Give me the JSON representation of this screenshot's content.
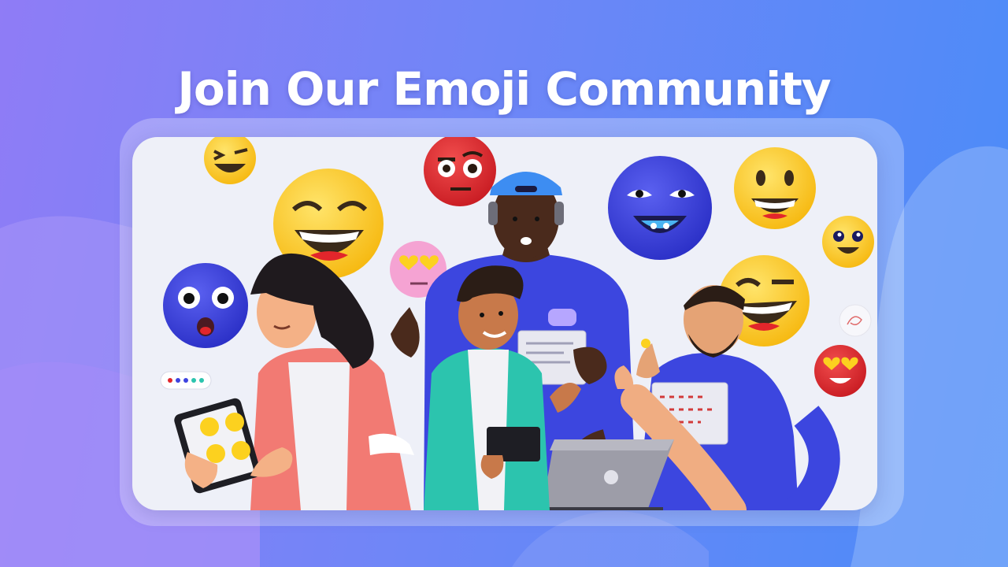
{
  "hero": {
    "title": "Join Our Emoji Community"
  },
  "illustration": {
    "emojis": [
      "winking-grin-emoji",
      "laughing-big-emoji",
      "skeptical-red-emoji",
      "heart-eyes-pink-emoji",
      "blue-surprised-emoji",
      "blue-grinning-emoji",
      "smiling-yellow-emoji",
      "small-smile-emoji",
      "laughing-right-emoji",
      "heart-eyes-red-emoji"
    ],
    "people": [
      "woman-with-tablet",
      "man-with-headphones",
      "boy-with-tablet",
      "bearded-man-with-laptop"
    ],
    "colors": {
      "emoji_yellow": "#fcd11f",
      "emoji_blue": "#3d43e0",
      "emoji_red": "#e2262b",
      "shirt_blue": "#3c46df",
      "shirt_teal": "#2cc4ae",
      "jacket_coral": "#f27a73"
    }
  }
}
